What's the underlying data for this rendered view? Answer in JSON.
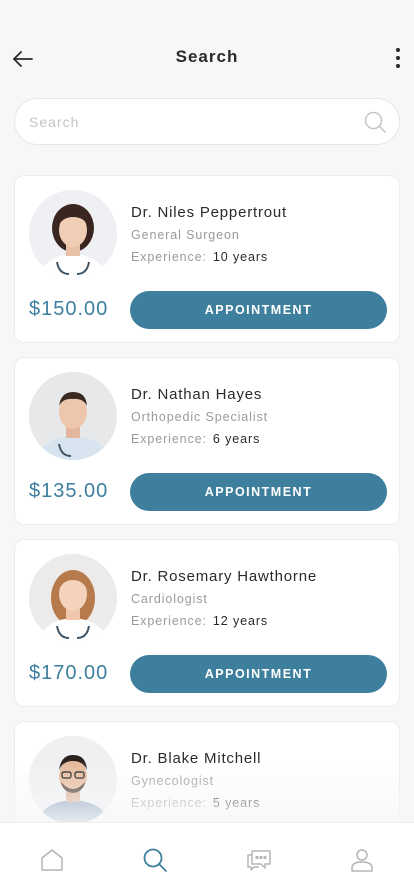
{
  "header": {
    "title": "Search",
    "back_icon": "arrow-left-icon",
    "more_icon": "more-vertical-icon"
  },
  "search": {
    "placeholder": "Search",
    "value": "",
    "icon": "search-icon"
  },
  "doctors": [
    {
      "name": "Dr. Niles Peppertrout",
      "specialty": "General Surgeon",
      "experience_label": "Experience:",
      "experience_value": "10 years",
      "price": "$150.00",
      "button_label": "APPOINTMENT"
    },
    {
      "name": "Dr. Nathan Hayes",
      "specialty": "Orthopedic Specialist",
      "experience_label": "Experience:",
      "experience_value": "6 years",
      "price": "$135.00",
      "button_label": "APPOINTMENT"
    },
    {
      "name": "Dr. Rosemary Hawthorne",
      "specialty": "Cardiologist",
      "experience_label": "Experience:",
      "experience_value": "12 years",
      "price": "$170.00",
      "button_label": "APPOINTMENT"
    },
    {
      "name": "Dr. Blake Mitchell",
      "specialty": "Gynecologist",
      "experience_label": "Experience:",
      "experience_value": "5 years"
    }
  ],
  "bottom_nav": [
    {
      "icon": "home-icon",
      "active": false
    },
    {
      "icon": "search-icon",
      "active": true
    },
    {
      "icon": "chat-icon",
      "active": false
    },
    {
      "icon": "profile-icon",
      "active": false
    }
  ],
  "colors": {
    "accent": "#3f7f9e",
    "price": "#3d7f9f",
    "inactive_icon": "#b5b5b5"
  }
}
